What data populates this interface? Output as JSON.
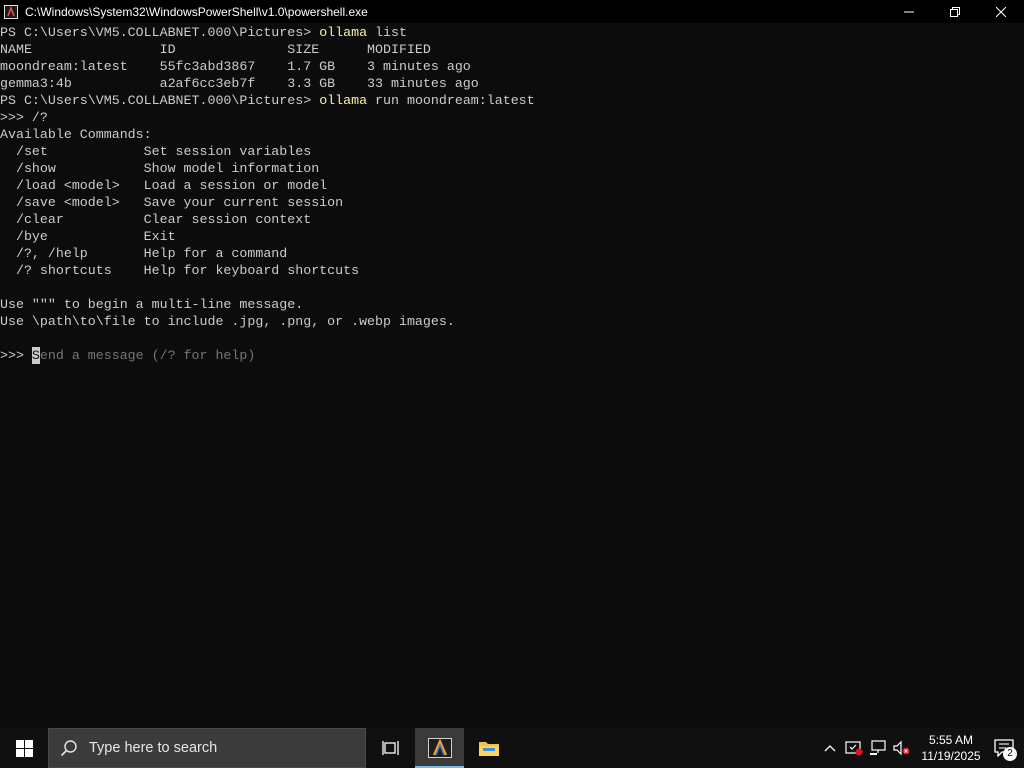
{
  "window": {
    "title": "C:\\Windows\\System32\\WindowsPowerShell\\v1.0\\powershell.exe",
    "icon": "powershell-icon",
    "controls": [
      "minimize-icon",
      "restore-icon",
      "close-icon"
    ]
  },
  "console": {
    "lines": [
      {
        "prefix": "PS C:\\Users\\VM5.COLLABNET.000\\Pictures> ",
        "cmd": "ollama",
        "rest": " list"
      },
      {
        "text": "NAME                ID              SIZE      MODIFIED"
      },
      {
        "text": "moondream:latest    55fc3abd3867    1.7 GB    3 minutes ago"
      },
      {
        "text": "gemma3:4b           a2af6cc3eb7f    3.3 GB    33 minutes ago"
      },
      {
        "prefix": "PS C:\\Users\\VM5.COLLABNET.000\\Pictures> ",
        "cmd": "ollama",
        "rest": " run moondream:latest"
      },
      {
        "text": ">>> /?"
      },
      {
        "text": "Available Commands:"
      },
      {
        "text": "  /set            Set session variables"
      },
      {
        "text": "  /show           Show model information"
      },
      {
        "text": "  /load <model>   Load a session or model"
      },
      {
        "text": "  /save <model>   Save your current session"
      },
      {
        "text": "  /clear          Clear session context"
      },
      {
        "text": "  /bye            Exit"
      },
      {
        "text": "  /?, /help       Help for a command"
      },
      {
        "text": "  /? shortcuts    Help for keyboard shortcuts"
      },
      {
        "text": ""
      },
      {
        "text": "Use \"\"\" to begin a multi-line message."
      },
      {
        "text": "Use \\path\\to\\file to include .jpg, .png, or .webp images."
      },
      {
        "text": ""
      }
    ],
    "prompt": {
      "marker": ">>> ",
      "cursor_char": "S",
      "placeholder_rest": "end a message (/? for help)"
    }
  },
  "taskbar": {
    "search_placeholder": "Type here to search",
    "items": [
      "task-view-icon",
      "powershell-app-icon",
      "file-explorer-icon"
    ],
    "clock_time": "5:55 AM",
    "clock_date": "11/19/2025",
    "notification_count": "2",
    "tray_icons": [
      "chevron-up-icon",
      "security-icon",
      "network-icon",
      "volume-muted-icon"
    ]
  },
  "colors": {
    "console_bg": "#0c0c0c",
    "console_text": "#cccccc",
    "command_highlight": "#f9f1a5",
    "placeholder": "#767676",
    "taskbar_bg": "#101010",
    "active_underline": "#76b9ed"
  }
}
